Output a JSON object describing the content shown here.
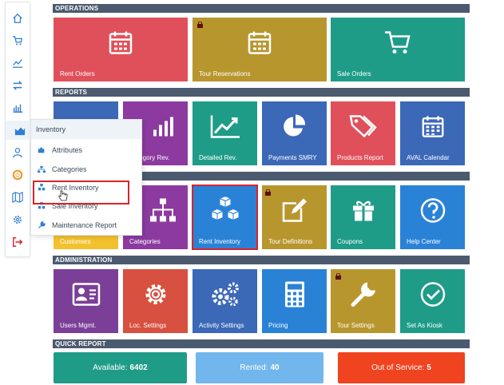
{
  "sidebar": {
    "icons": [
      "home-icon",
      "cart-icon",
      "trend-chart-icon",
      "exchange-icon",
      "bar-chart-icon",
      "area-chart-icon",
      "users-icon",
      "lifebuoy-icon",
      "map-icon",
      "gear-icon",
      "logout-icon"
    ]
  },
  "flyout": {
    "title": "Inventory",
    "items": [
      {
        "label": "Attributes",
        "icon": "puzzle-icon"
      },
      {
        "label": "Categories",
        "icon": "sitemap-icon"
      },
      {
        "label": "Rent Inventory",
        "icon": "cubes-icon"
      },
      {
        "label": "Sale Inventory",
        "icon": "cubes-icon"
      },
      {
        "label": "Maintenance Report",
        "icon": "wrench-icon"
      }
    ]
  },
  "sections": {
    "operations": "OPERATIONS",
    "reports": "REPORTS",
    "administration": "ADMINISTRATION",
    "quick_report": "QUICK REPORT"
  },
  "operations": [
    {
      "label": "Rent Orders",
      "icon": "calendar-icon",
      "color": "#e0505a",
      "locked": false
    },
    {
      "label": "Tour Reservations",
      "icon": "calendar-icon",
      "color": "#b8962e",
      "locked": true
    },
    {
      "label": "Sale Orders",
      "icon": "cart-icon",
      "color": "#1f9c88",
      "locked": false
    }
  ],
  "reports": [
    {
      "label": "",
      "icon": "",
      "color": "#3b68b7"
    },
    {
      "label": "tegory Rev.",
      "icon": "bar-chart-icon",
      "color": "#8c3aa0"
    },
    {
      "label": "Detailed Rev.",
      "icon": "trend-chart-icon",
      "color": "#1f9c88"
    },
    {
      "label": "Payments SMRY",
      "icon": "pie-chart-icon",
      "color": "#3b68b7"
    },
    {
      "label": "Products Report",
      "icon": "tags-icon",
      "color": "#e0505a"
    },
    {
      "label": "AVAL Calendar",
      "icon": "calendar-icon",
      "color": "#3b68b7"
    }
  ],
  "inventory": [
    {
      "label": "Customers",
      "icon": "",
      "color": "#f2c12e"
    },
    {
      "label": "Categories",
      "icon": "sitemap-icon",
      "color": "#8c3aa0"
    },
    {
      "label": "Rent Inventory",
      "icon": "cubes-icon",
      "color": "#2a82d7"
    },
    {
      "label": "Tour Definitions",
      "icon": "edit-icon",
      "color": "#b8962e",
      "locked": true
    },
    {
      "label": "Coupons",
      "icon": "gift-icon",
      "color": "#1f9c88"
    },
    {
      "label": "Help Center",
      "icon": "question-icon",
      "color": "#2a82d7"
    }
  ],
  "administration": [
    {
      "label": "Users Mgmt.",
      "icon": "id-card-icon",
      "color": "#7b3f98"
    },
    {
      "label": "Loc. Settings",
      "icon": "gear-icon",
      "color": "#d8503f"
    },
    {
      "label": "Activity Settings",
      "icon": "gears-icon",
      "color": "#3b68b7"
    },
    {
      "label": "Pricing",
      "icon": "calculator-icon",
      "color": "#2a82d7"
    },
    {
      "label": "Tour Settings",
      "icon": "wrench-icon",
      "color": "#b8962e",
      "locked": true
    },
    {
      "label": "Set As Kiosk",
      "icon": "check-circle-icon",
      "color": "#1f9c88"
    }
  ],
  "quick_report": {
    "available_label": "Available:",
    "available_value": "6402",
    "rented_label": "Rented:",
    "rented_value": "40",
    "out_of_service_label": "Out of Service:",
    "out_of_service_value": "5",
    "colors": {
      "available": "#1f9c88",
      "rented": "#72b6ee",
      "out_of_service": "#f0431f"
    }
  }
}
